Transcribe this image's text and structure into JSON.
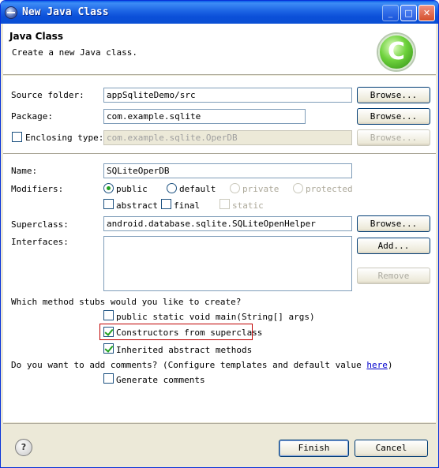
{
  "window": {
    "title": "New Java Class"
  },
  "banner": {
    "title": "Java Class",
    "description": "Create a new Java class."
  },
  "form": {
    "source_folder_label": "Source folder:",
    "source_folder_value": "appSqliteDemo/src",
    "package_label": "Package:",
    "package_value": "com.example.sqlite",
    "enclosing_type_label": "Enclosing type:",
    "enclosing_type_value": "com.example.sqlite.OperDB",
    "name_label": "Name:",
    "name_value": "SQLiteOperDB",
    "modifiers_label": "Modifiers:",
    "mod_public": "public",
    "mod_default": "default",
    "mod_private": "private",
    "mod_protected": "protected",
    "mod_abstract": "abstract",
    "mod_final": "final",
    "mod_static": "static",
    "superclass_label": "Superclass:",
    "superclass_value": "android.database.sqlite.SQLiteOpenHelper",
    "interfaces_label": "Interfaces:"
  },
  "buttons": {
    "browse": "Browse...",
    "add": "Add...",
    "remove": "Remove",
    "finish": "Finish",
    "cancel": "Cancel"
  },
  "stubs": {
    "question": "Which method stubs would you like to create?",
    "main": "public static void main(String[] args)",
    "constructors": "Constructors from superclass",
    "inherited": "Inherited abstract methods"
  },
  "comments": {
    "question": "Do you want to add comments? (Configure templates and default value ",
    "link": "here",
    "close": ")",
    "generate": "Generate comments"
  },
  "colors": {
    "highlight_border": "#c00000",
    "title_bar": "#0a5ee8"
  },
  "icons": {
    "title": "eclipse-icon",
    "banner": "java-class-wizard-icon",
    "help": "help-icon"
  }
}
